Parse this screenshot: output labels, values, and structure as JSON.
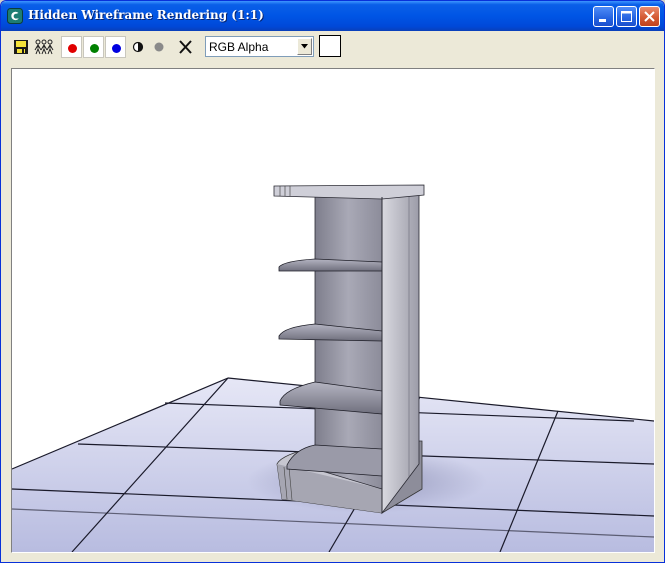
{
  "window": {
    "title": "Hidden Wireframe Rendering (1:1)",
    "title_color": "#ffffff",
    "titlebar_color": "#0055e5"
  },
  "titlebar_buttons": [
    {
      "name": "minimize-button",
      "icon": "minimize-icon"
    },
    {
      "name": "maximize-button",
      "icon": "maximize-icon"
    },
    {
      "name": "close-button",
      "icon": "close-icon"
    }
  ],
  "toolbar": {
    "tools": [
      {
        "name": "save-image-button",
        "icon": "floppy-disk-icon"
      },
      {
        "name": "clone-window-button",
        "icon": "clone-figures-icon"
      },
      {
        "name": "red-channel-button",
        "icon": "red-channel-icon",
        "color": "#e00000"
      },
      {
        "name": "green-channel-button",
        "icon": "green-channel-icon",
        "color": "#008000"
      },
      {
        "name": "blue-channel-button",
        "icon": "blue-channel-icon",
        "color": "#0000e0"
      },
      {
        "name": "monochrome-button",
        "icon": "monochrome-icon"
      },
      {
        "name": "alpha-channel-button",
        "icon": "gray-dot-icon",
        "color": "#8a8a8a"
      },
      {
        "name": "clear-button",
        "icon": "x-icon"
      }
    ],
    "channel_select": {
      "selected": "RGB Alpha"
    },
    "pixel_color": "#ffffff"
  },
  "viewport": {
    "background": "#ffffff",
    "floor_color": "#c8cbe8",
    "object": "shelf-unit-render"
  }
}
